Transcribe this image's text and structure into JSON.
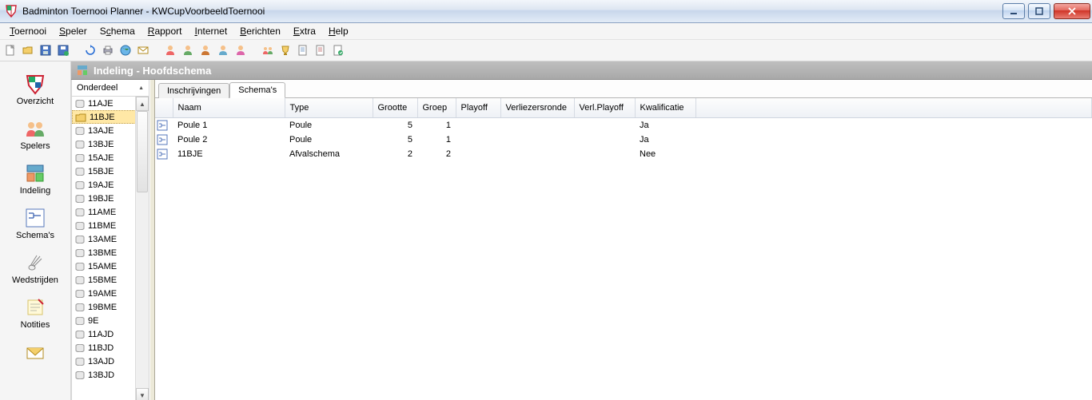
{
  "titlebar": {
    "title": "Badminton Toernooi Planner - KWCupVoorbeeldToernooi"
  },
  "menu": {
    "items": [
      "Toernooi",
      "Speler",
      "Schema",
      "Rapport",
      "Internet",
      "Berichten",
      "Extra",
      "Help"
    ]
  },
  "leftnav": {
    "items": [
      {
        "label": "Overzicht",
        "icon": "shield"
      },
      {
        "label": "Spelers",
        "icon": "people"
      },
      {
        "label": "Indeling",
        "icon": "layout"
      },
      {
        "label": "Schema's",
        "icon": "schema"
      },
      {
        "label": "Wedstrijden",
        "icon": "shuttle"
      },
      {
        "label": "Notities",
        "icon": "note"
      },
      {
        "label": "",
        "icon": "mail"
      }
    ]
  },
  "header": {
    "title": "Indeling - Hoofdschema"
  },
  "onderdeel": {
    "header": "Onderdeel",
    "selected": "11BJE",
    "items": [
      "11AJE",
      "11BJE",
      "13AJE",
      "13BJE",
      "15AJE",
      "15BJE",
      "19AJE",
      "19BJE",
      "11AME",
      "11BME",
      "13AME",
      "13BME",
      "15AME",
      "15BME",
      "19AME",
      "19BME",
      "9E",
      "11AJD",
      "11BJD",
      "13AJD",
      "13BJD"
    ]
  },
  "tabs": {
    "items": [
      "Inschrijvingen",
      "Schema's"
    ],
    "active": 1
  },
  "grid": {
    "columns": [
      "Naam",
      "Type",
      "Grootte",
      "Groep",
      "Playoff",
      "Verliezersronde",
      "Verl.Playoff",
      "Kwalificatie"
    ],
    "rows": [
      {
        "naam": "Poule 1",
        "type": "Poule",
        "grootte": "5",
        "groep": "1",
        "playoff": "",
        "verliezers": "",
        "verlplayoff": "",
        "kwal": "Ja"
      },
      {
        "naam": "Poule 2",
        "type": "Poule",
        "grootte": "5",
        "groep": "1",
        "playoff": "",
        "verliezers": "",
        "verlplayoff": "",
        "kwal": "Ja"
      },
      {
        "naam": "11BJE",
        "type": "Afvalschema",
        "grootte": "2",
        "groep": "2",
        "playoff": "",
        "verliezers": "",
        "verlplayoff": "",
        "kwal": "Nee"
      }
    ]
  }
}
